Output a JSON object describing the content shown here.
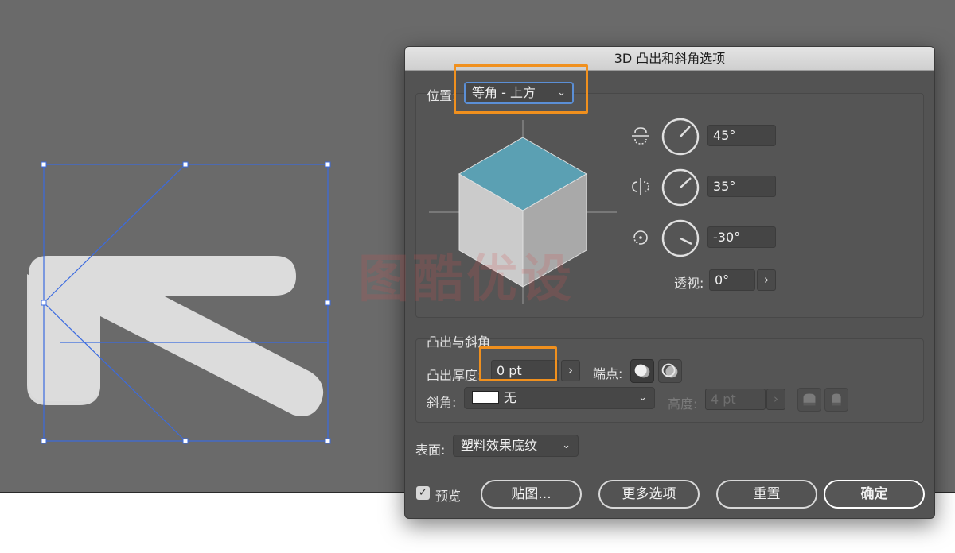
{
  "dialog": {
    "title": "3D 凸出和斜角选项"
  },
  "position": {
    "label": "位置:",
    "value": "等角 - 上方"
  },
  "rotation": {
    "x_angle": "45°",
    "y_angle": "35°",
    "z_angle": "-30°",
    "perspective_label": "透视:",
    "perspective_value": "0°"
  },
  "extrude": {
    "section_title": "凸出与斜角",
    "depth_label": "凸出厚度:",
    "depth_value": "0 pt",
    "cap_label": "端点:",
    "bevel_label": "斜角:",
    "bevel_value": "无",
    "height_label": "高度:",
    "height_value": "4 pt"
  },
  "surface": {
    "label": "表面:",
    "value": "塑料效果底纹"
  },
  "footer": {
    "preview_label": "预览",
    "map_button": "贴图...",
    "more_button": "更多选项",
    "reset_button": "重置",
    "ok_button": "确定"
  },
  "watermark": "图酷优设",
  "colors": {
    "canvas_bg": "#6a6a6a",
    "dialog_bg": "#535353",
    "cube_top": "#5ba0b3",
    "cube_left": "#cbcbcb",
    "cube_right": "#a9a9a9",
    "highlight": "#f0901e",
    "selection": "#3b6be0",
    "arrow_shape": "#dcdcdc"
  }
}
